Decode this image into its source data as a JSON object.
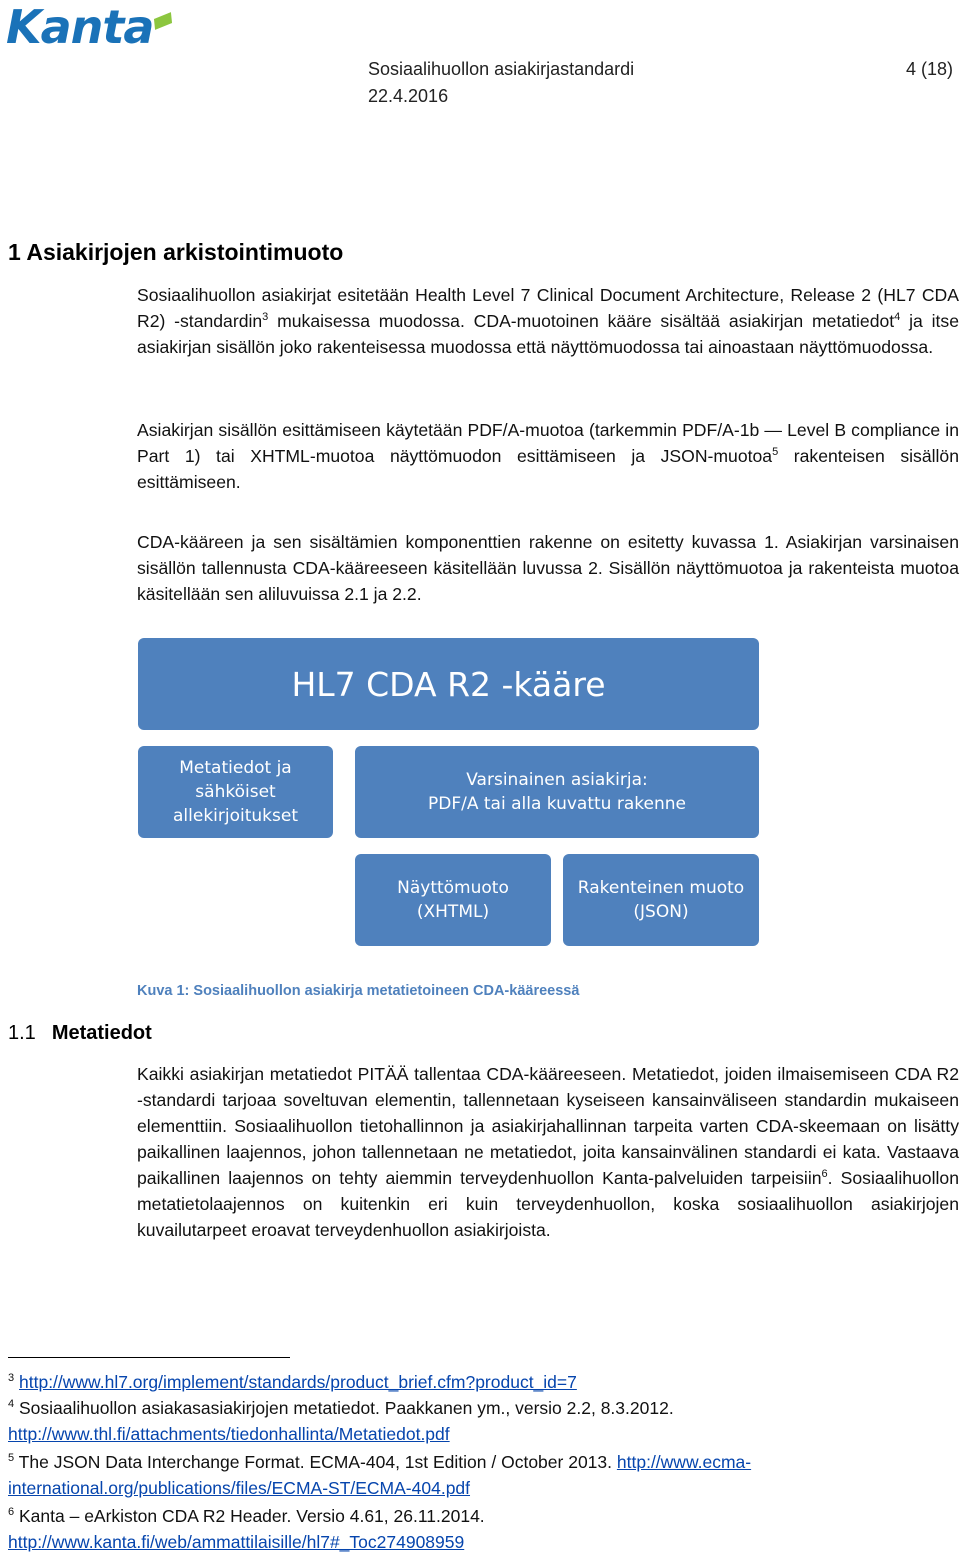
{
  "logo": {
    "text": "Kanta"
  },
  "header": {
    "title": "Sosiaalihuollon asiakirjastandardi",
    "page": "4 (18)",
    "date": "22.4.2016"
  },
  "section1": {
    "heading": "1 Asiakirjojen arkistointimuoto",
    "p1": {
      "a": "Sosiaalihuollon asiakirjat esitetään Health Level 7 Clinical Document Architecture, Release 2 (HL7 CDA R2) -standardin",
      "sup1": "3",
      "b": " mukaisessa muodossa. CDA-muotoinen kääre sisältää asiakirjan metatiedot",
      "sup2": "4",
      "c": " ja itse asiakirjan sisällön joko rakenteisessa muodossa että näyttömuodossa tai ainoastaan näyttömuodossa."
    },
    "p2": {
      "a": "Asiakirjan sisällön esittämiseen käytetään PDF/A-muotoa (tarkemmin PDF/A-1b — Level B compliance in Part 1) tai XHTML-muotoa näyttömuodon esittämiseen ja JSON-muotoa",
      "sup": "5",
      "b": " rakenteisen sisällön esittämiseen."
    },
    "p3": "CDA-kääreen ja sen sisältämien komponenttien rakenne on esitetty kuvassa 1. Asiakirjan varsinaisen sisällön tallennusta CDA-kääreeseen käsitellään luvussa 2. Sisällön näyttömuotoa ja rakenteista muotoa käsitellään sen aliluvuissa 2.1 ja 2.2."
  },
  "diagram": {
    "main": "HL7 CDA R2 -kääre",
    "meta": [
      "Metatiedot ja",
      "sähköiset",
      "allekirjoitukset"
    ],
    "doc": [
      "Varsinainen asiakirja:",
      "PDF/A tai alla kuvattu rakenne"
    ],
    "view": [
      "Näyttömuoto",
      "(XHTML)"
    ],
    "struct": [
      "Rakenteinen muoto",
      "(JSON)"
    ],
    "caption": "Kuva 1: Sosiaalihuollon asiakirja metatietoineen CDA-kääreessä",
    "color": "#4f81bd"
  },
  "section11": {
    "number": "1.1",
    "heading": "Metatiedot",
    "p1": {
      "a": "Kaikki asiakirjan metatiedot PITÄÄ tallentaa CDA-kääreeseen. Metatiedot, joiden ilmaisemiseen CDA R2 -standardi tarjoaa soveltuvan elementin, tallennetaan kyseiseen kansainväliseen standardin mukaiseen elementtiin. Sosiaalihuollon tietohallinnon ja asiakirjahallinnan tarpeita varten CDA-skeemaan on lisätty paikallinen laajennos, johon tallennetaan ne metatiedot, joita kansainvälinen standardi ei kata. Vastaava paikallinen laajennos on tehty aiemmin terveydenhuollon Kanta-palveluiden tarpeisiin",
      "sup": "6",
      "b": ". Sosiaalihuollon metatietolaajennos on kuitenkin eri kuin terveydenhuollon, koska sosiaalihuollon asiakirjojen kuvailutarpeet eroavat terveydenhuollon asiakirjoista."
    }
  },
  "footnotes": [
    {
      "num": "3",
      "text": "",
      "link": "http://www.hl7.org/implement/standards/product_brief.cfm?product_id=7"
    },
    {
      "num": "4",
      "text": "Sosiaalihuollon asiakasasiakirjojen metatiedot. Paakkanen ym., versio 2.2, 8.3.2012.",
      "link": "http://www.thl.fi/attachments/tiedonhallinta/Metatiedot.pdf"
    },
    {
      "num": "5",
      "text": "The JSON Data Interchange Format. ECMA-404, 1st Edition / October 2013.",
      "link": "http://www.ecma-international.org/publications/files/ECMA-ST/ECMA-404.pdf"
    },
    {
      "num": "6",
      "text": "Kanta – eArkiston CDA R2 Header. Versio 4.61, 26.11.2014.",
      "link": "http://www.kanta.fi/web/ammattilaisille/hl7#_Toc274908959"
    }
  ]
}
